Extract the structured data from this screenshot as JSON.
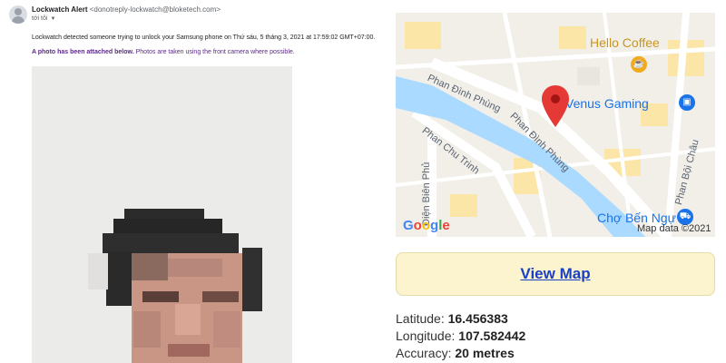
{
  "email": {
    "sender_name": "Lockwatch Alert",
    "sender_email": "<donotreply-lockwatch@bloketech.com>",
    "to": "tới tôi",
    "message": "Lockwatch detected someone trying to unlock your Samsung phone on Thứ sáu, 5 tháng 3, 2021 at 17:59:02 GMT+07:00.",
    "photo_note_bold": "A photo has been attached below.",
    "photo_note_rest": " Photos are taken using the front camera where possible."
  },
  "map": {
    "streets": [
      "Phan Đình Phùng",
      "Phan Đình Phùng",
      "Phan Chu Trinh",
      "Điện Biên Phủ",
      "Phan Bội Châu"
    ],
    "pois": [
      {
        "name": "Hello Coffee",
        "color": "#c8961e",
        "icon": "coffee-icon"
      },
      {
        "name": "Venus Gaming",
        "color": "#1a73e8",
        "icon": "shopping-bag-icon"
      },
      {
        "name": "Chợ Bến Ngự",
        "color": "#1a73e8",
        "icon": "shopping-cart-icon"
      }
    ],
    "marker_color": "#e53935",
    "google": [
      "G",
      "o",
      "o",
      "g",
      "l",
      "e"
    ],
    "attribution": "Map data ©2021"
  },
  "view_map_label": "View Map",
  "location": {
    "latitude_label": "Latitude:",
    "latitude": "16.456383",
    "longitude_label": "Longitude:",
    "longitude": "107.582442",
    "accuracy_label": "Accuracy:",
    "accuracy": "20 metres"
  }
}
